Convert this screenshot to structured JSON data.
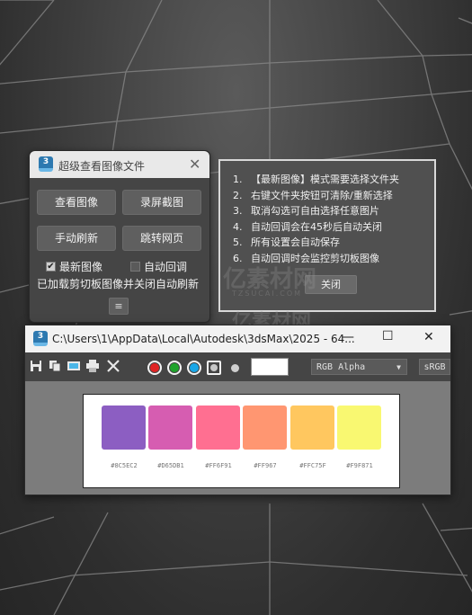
{
  "tool_window": {
    "title": "超级查看图像文件",
    "icon_label": "3",
    "buttons": [
      "查看图像",
      "录屏截图",
      "手动刷新",
      "跳转网页"
    ],
    "checkbox_latest": {
      "label": "最新图像",
      "checked": true
    },
    "checkbox_auto_close": {
      "label": "自动回调",
      "checked": false
    },
    "status_text": "已加载剪切板图像并关闭自动刷新",
    "collapse_label": "≡"
  },
  "help_panel": {
    "items": [
      {
        "num": "1.",
        "text": "【最新图像】模式需要选择文件夹"
      },
      {
        "num": "2.",
        "text": "右键文件夹按钮可清除/重新选择"
      },
      {
        "num": "3.",
        "text": "取消勾选可自由选择任意图片"
      },
      {
        "num": "4.",
        "text": "自动回调会在45秒后自动关闭"
      },
      {
        "num": "5.",
        "text": "所有设置会自动保存"
      },
      {
        "num": "6.",
        "text": "自动回调时会监控剪切板图像"
      }
    ],
    "close_label": "关闭"
  },
  "watermark": {
    "text": "亿素材网",
    "sub": "TZSUCAI.COM"
  },
  "viewer_window": {
    "title": "C:\\Users\\1\\AppData\\Local\\Autodesk\\3dsMax\\2025 - 64...",
    "icon_label": "3",
    "channel_select": "RGB Alpha",
    "srgb_label": "sRGB",
    "toolbar_icons": [
      "save-icon",
      "copy-icon",
      "clone-icon",
      "print-icon",
      "clear-icon"
    ],
    "channel_colors": {
      "red": "#e02424",
      "green": "#1fa32b",
      "blue": "#1aa7e8"
    },
    "palette": [
      {
        "hex": "#8C5EC2",
        "label": "#8C5EC2"
      },
      {
        "hex": "#D65DB1",
        "label": "#D65DB1"
      },
      {
        "hex": "#FF6F91",
        "label": "#FF6F91"
      },
      {
        "hex": "#FF9671",
        "label": "#FF967"
      },
      {
        "hex": "#FFC75F",
        "label": "#FFC75F"
      },
      {
        "hex": "#F9F871",
        "label": "#F9F871"
      }
    ]
  }
}
